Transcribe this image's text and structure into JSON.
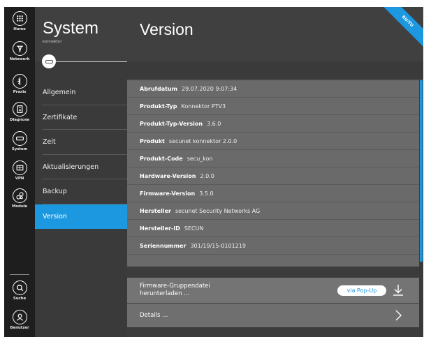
{
  "rail": {
    "items": [
      {
        "label": "Home",
        "icon": "grid-icon"
      },
      {
        "label": "Netzwerk",
        "icon": "network-icon"
      },
      {
        "label": "Praxis",
        "icon": "caduceus-icon"
      },
      {
        "label": "Diagnose",
        "icon": "document-icon"
      },
      {
        "label": "System",
        "icon": "hardware-icon"
      },
      {
        "label": "VPN",
        "icon": "vpn-icon"
      },
      {
        "label": "Module",
        "icon": "modules-icon"
      },
      {
        "label": "Suche",
        "icon": "search-icon"
      },
      {
        "label": "Benutzer",
        "icon": "user-icon"
      }
    ]
  },
  "nav": {
    "title": "System",
    "subtitle": "konnektor",
    "items": [
      {
        "label": "Allgemein"
      },
      {
        "label": "Zertifikate"
      },
      {
        "label": "Zeit"
      },
      {
        "label": "Aktualisierungen"
      },
      {
        "label": "Backup"
      },
      {
        "label": "Version",
        "active": true
      }
    ]
  },
  "main": {
    "title": "Version",
    "ribbon": "RU/TU",
    "rows": [
      {
        "label": "Abrufdatum",
        "value": "29.07.2020 9:07:34"
      },
      {
        "label": "Produkt-Typ",
        "value": "Konnektor PTV3"
      },
      {
        "label": "Produkt-Typ-Version",
        "value": "3.6.0"
      },
      {
        "label": "Produkt",
        "value": "secunet konnektor 2.0.0"
      },
      {
        "label": "Produkt-Code",
        "value": "secu_kon"
      },
      {
        "label": "Hardware-Version",
        "value": "2.0.0"
      },
      {
        "label": "Firmware-Version",
        "value": "3.5.0"
      },
      {
        "label": "Hersteller",
        "value": "secunet Security Networks AG"
      },
      {
        "label": "Hersteller-ID",
        "value": "SECUN"
      },
      {
        "label": "Seriennummer",
        "value": "301/19/15-0101219"
      }
    ],
    "firmware_download": {
      "line1": "Firmware-Gruppendatei",
      "line2": "herunterladen ...",
      "button": "via Pop-Up"
    },
    "details_label": "Details ..."
  },
  "colors": {
    "accent": "#1b98e0",
    "rail_bg": "#1e1e1e",
    "content_bg": "#6a6a6a"
  }
}
